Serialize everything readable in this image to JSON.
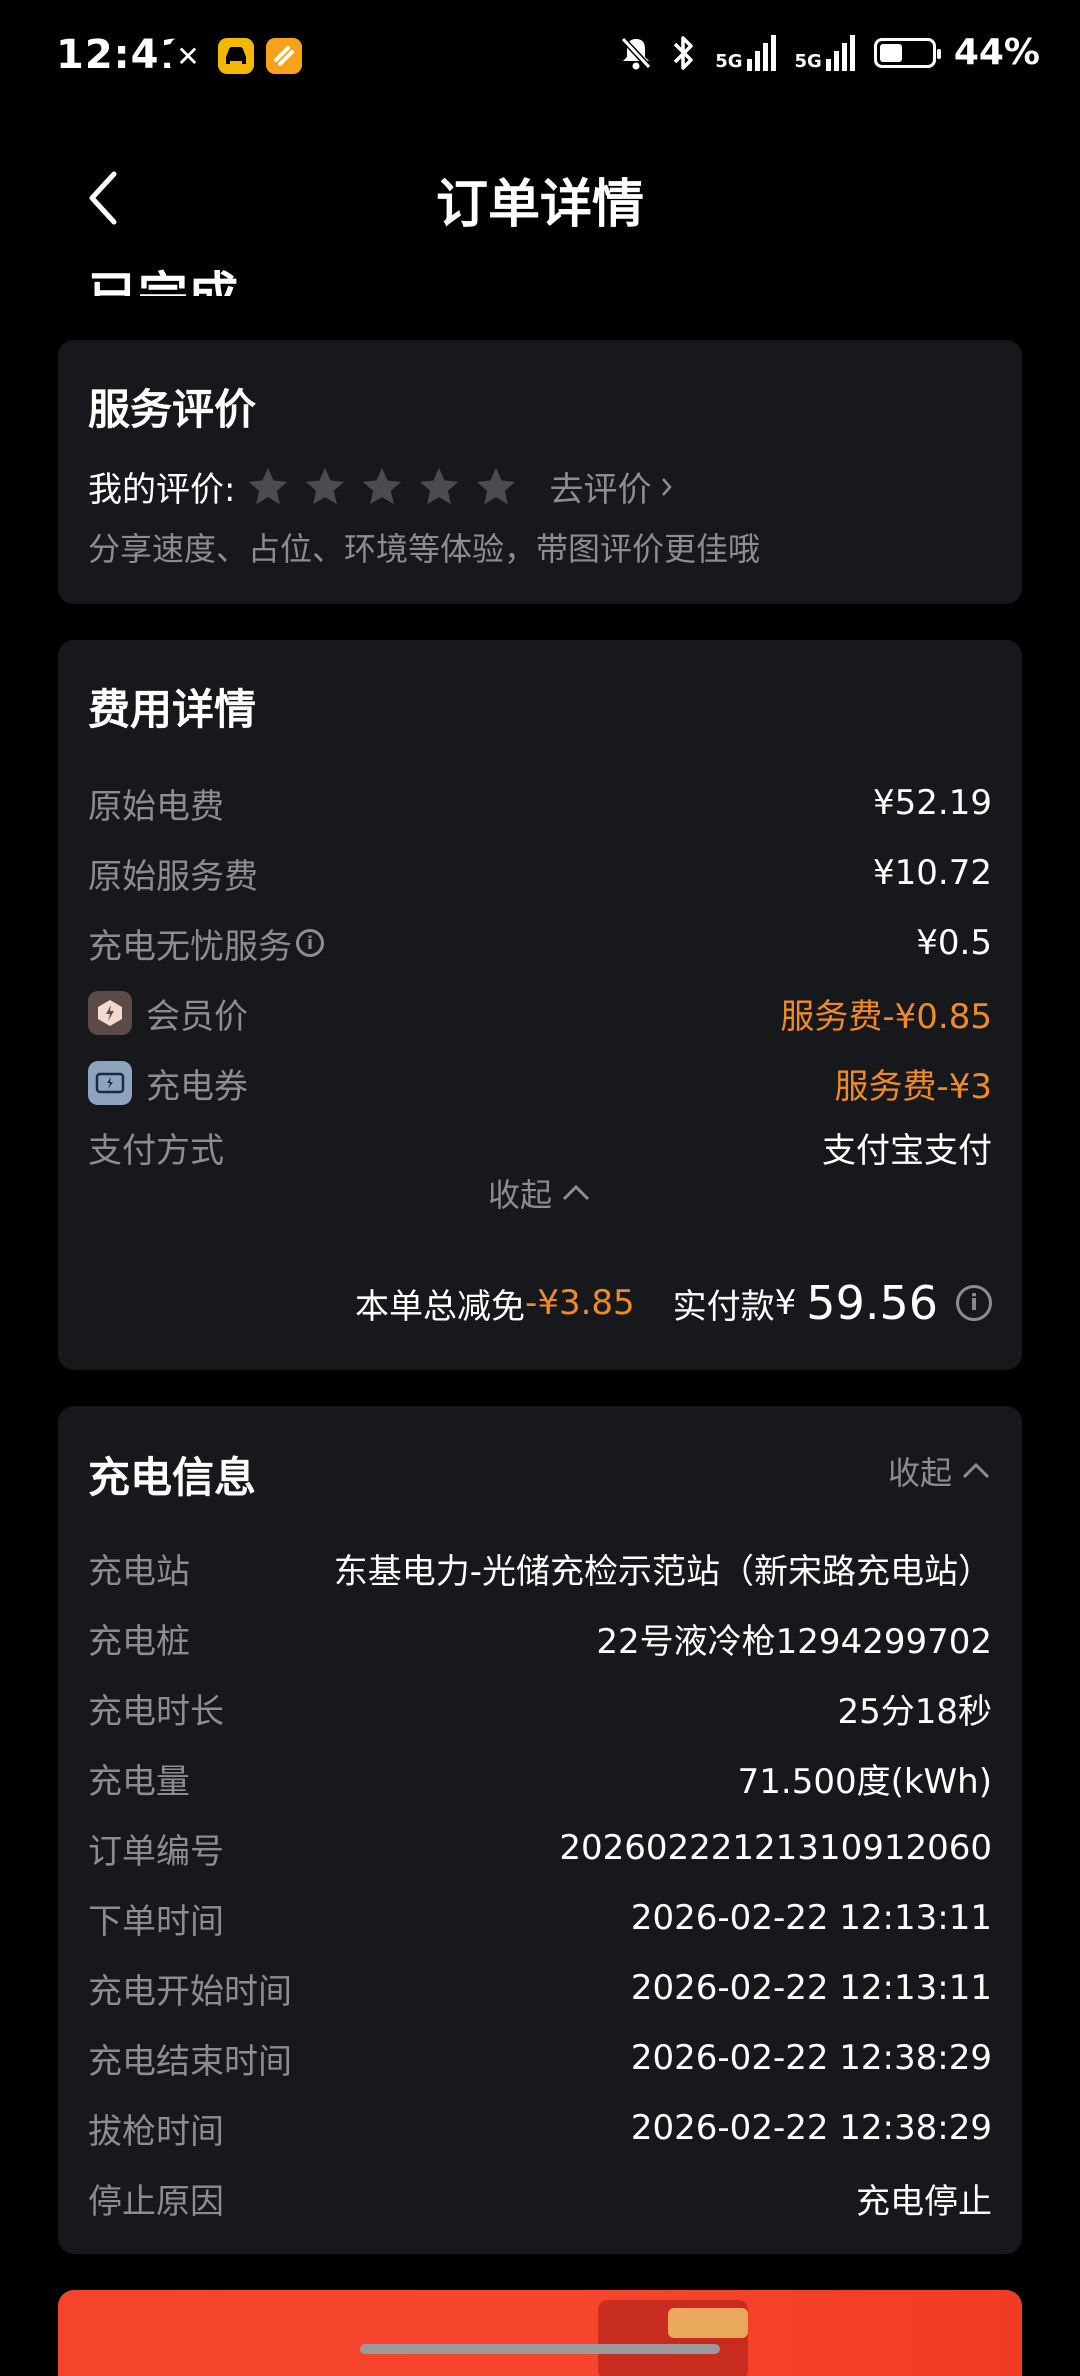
{
  "status_bar": {
    "time": "12:41",
    "network_1": "5G",
    "network_2": "5G",
    "battery_percent": "44%",
    "battery_level": 0.44
  },
  "header": {
    "title": "订单详情",
    "partial_status": "已完成"
  },
  "rating": {
    "title": "服务评价",
    "my_rating_label": "我的评价:",
    "stars_filled": 0,
    "stars_total": 5,
    "go_rate_label": "去评价",
    "hint": "分享速度、占位、环境等体验，带图评价更佳哦"
  },
  "fees": {
    "title": "费用详情",
    "rows": [
      {
        "label": "原始电费",
        "value": "¥52.19"
      },
      {
        "label": "原始服务费",
        "value": "¥10.72"
      },
      {
        "label": "充电无忧服务",
        "value": "¥0.5"
      },
      {
        "label": "会员价",
        "value": "服务费-¥0.85"
      },
      {
        "label": "充电券",
        "value": "服务费-¥3"
      },
      {
        "label": "支付方式",
        "value": "支付宝支付"
      }
    ],
    "collapse_label": "收起",
    "total_discount_label": "本单总减免",
    "total_discount_value": "-¥3.85",
    "paid_label": "实付款",
    "paid_currency": "¥",
    "paid_amount": "59.56"
  },
  "charging": {
    "title": "充电信息",
    "collapse_label": "收起",
    "rows": [
      {
        "label": "充电站",
        "value": "东基电力-光储充检示范站（新宋路充电站）"
      },
      {
        "label": "充电桩",
        "value": "22号液冷枪1294299702"
      },
      {
        "label": "充电时长",
        "value": "25分18秒"
      },
      {
        "label": "充电量",
        "value": "71.500度(kWh)"
      },
      {
        "label": "订单编号",
        "value": "20260222121310912060"
      },
      {
        "label": "下单时间",
        "value": "2026-02-22 12:13:11"
      },
      {
        "label": "充电开始时间",
        "value": "2026-02-22 12:13:11"
      },
      {
        "label": "充电结束时间",
        "value": "2026-02-22 12:38:29"
      },
      {
        "label": "拔枪时间",
        "value": "2026-02-22 12:38:29"
      },
      {
        "label": "停止原因",
        "value": "充电停止"
      }
    ]
  },
  "colors": {
    "accent_orange": "#f08a24",
    "card_bg": "#17181c",
    "label_gray": "#8c8d92"
  }
}
